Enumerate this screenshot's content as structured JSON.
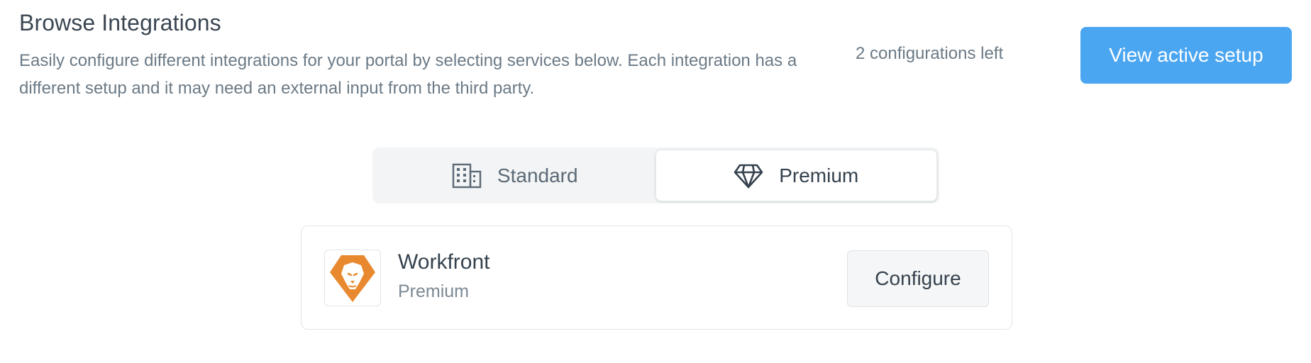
{
  "header": {
    "title": "Browse Integrations",
    "description": "Easily configure different integrations for your portal by selecting services below. Each integration has a different setup and it may need an external input from the third party.",
    "configurations_left": "2 configurations left",
    "view_button_label": "View active setup"
  },
  "tabs": [
    {
      "label": "Standard",
      "icon": "building-icon",
      "active": false
    },
    {
      "label": "Premium",
      "icon": "diamond-icon",
      "active": true
    }
  ],
  "integrations": [
    {
      "name": "Workfront",
      "tier": "Premium",
      "logo": "workfront-lion-logo",
      "action_label": "Configure"
    }
  ],
  "colors": {
    "accent": "#4ba6f2",
    "logo_orange": "#e8892f"
  }
}
